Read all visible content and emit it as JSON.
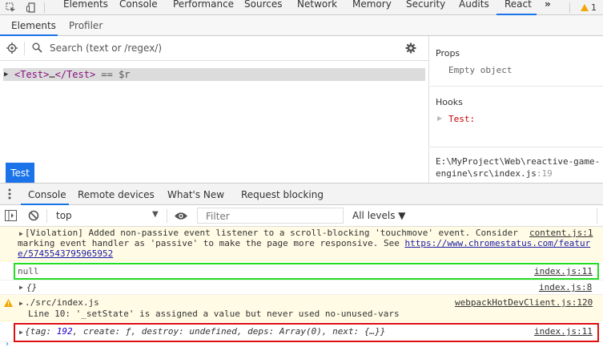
{
  "topbar": {
    "tabs": [
      "Elements",
      "Console",
      "Performance",
      "Sources",
      "Network",
      "Memory",
      "Security",
      "Audits",
      "React"
    ],
    "active_tab": "React",
    "overflow": "»",
    "warning_count": "1"
  },
  "react_tabs": [
    "Elements",
    "Profiler"
  ],
  "search": {
    "placeholder": "Search (text or /regex/)"
  },
  "tree": {
    "open_tag": "<Test>",
    "ellipsis": "…",
    "close_tag": "</Test>",
    "suffix": "== $r"
  },
  "component_button": "Test",
  "sidebar": {
    "props_title": "Props",
    "props_empty": "Empty object",
    "hooks_title": "Hooks",
    "hook_name": "Test:",
    "source_line1": "E:\\MyProject\\Web\\reactive-game-",
    "source_line2": "engine\\src\\index.js",
    "source_line_no": ":19"
  },
  "drawer_tabs": [
    "Console",
    "Remote devices",
    "What's New",
    "Request blocking"
  ],
  "console_toolbar": {
    "context": "top",
    "filter_placeholder": "Filter",
    "levels": "All levels ▼"
  },
  "messages": {
    "violation": {
      "line1": "[Violation] Added non-passive event listener to a scroll-blocking 'touchmove' event. Consider",
      "line2_pre": "marking event handler as 'passive' to make the page more responsive. See ",
      "link_a": "https://www.chromestatus.com/featur",
      "link_b": "e/5745543795965952",
      "source": "content.js:1"
    },
    "null_msg": {
      "text": "null",
      "source": "index.js:11"
    },
    "object_msg": {
      "text": "{}",
      "source": "index.js:8"
    },
    "warning": {
      "line1": "./src/index.js",
      "line2": "Line 10:  '_setState' is assigned a value but never used  no-unused-vars",
      "source": "webpackHotDevClient.js:120"
    },
    "hook_msg": {
      "p1": "{tag: ",
      "tag_val": "192",
      "p2": ", create: ƒ, destroy: undefined, deps: Array(0), next: {…}}",
      "source": "index.js:11"
    }
  },
  "colors": {
    "accent": "#1a73e8",
    "highlight_green": "#22dd22",
    "highlight_red": "#e01010",
    "warn_bg": "#fffbe5"
  }
}
